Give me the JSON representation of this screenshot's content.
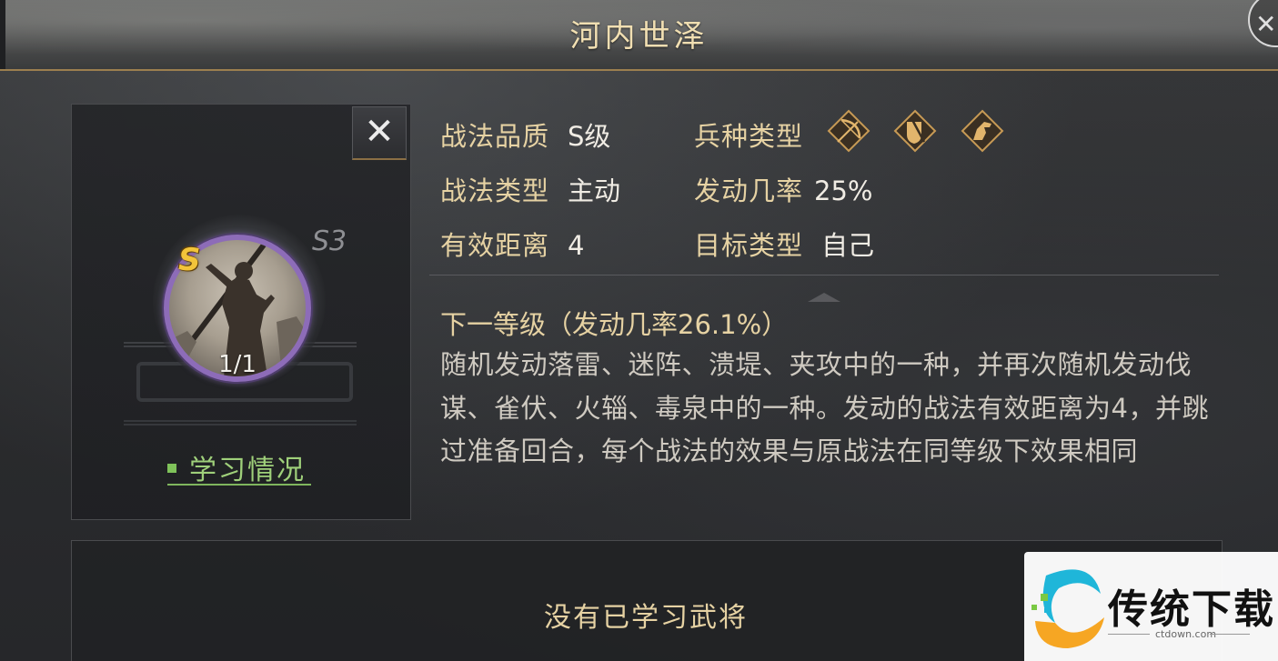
{
  "header": {
    "title": "河内世泽"
  },
  "skill": {
    "grade_badge": "S",
    "season": "S3",
    "count": "1/1",
    "learn_status_label": "学习情况"
  },
  "stats": {
    "quality_label": "战法品质",
    "quality_value": "S级",
    "type_label": "战法类型",
    "type_value": "主动",
    "range_label": "有效距离",
    "range_value": "4",
    "troop_label": "兵种类型",
    "troop_icons": [
      "archer-icon",
      "shield-icon",
      "cavalry-icon"
    ],
    "rate_label": "发动几率",
    "rate_value": "25%",
    "target_label": "目标类型",
    "target_value": "自己"
  },
  "next_level": "下一等级（发动几率26.1%）",
  "description": "随机发动落雷、迷阵、溃堤、夹攻中的一种，并再次随机发动伐谋、雀伏、火辎、毒泉中的一种。发动的战法有效距离为4，并跳过准备回合，每个战法的效果与原战法在同等级下效果相同",
  "learned_generals": {
    "empty_text": "没有已学习武将"
  },
  "watermark": {
    "brand": "传统下载",
    "url": "ctdown.com"
  },
  "colors": {
    "title": "#f1dfb2",
    "label": "#e6d2a3",
    "value": "#f0ece4",
    "purple_ring": "#8d6cb8",
    "grade_gold": "#f2c43a",
    "learn_green": "#9fd07a"
  }
}
